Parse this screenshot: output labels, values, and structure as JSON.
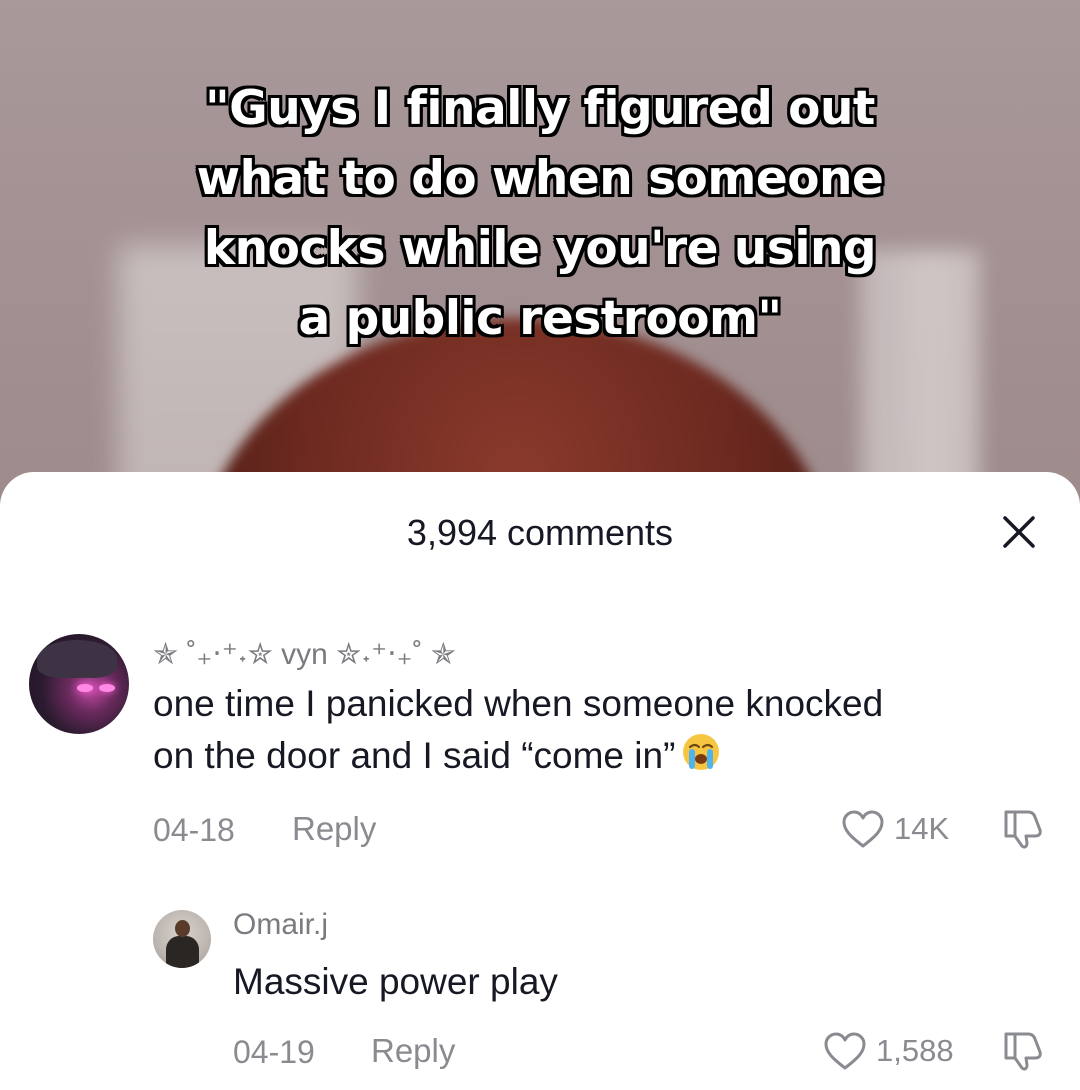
{
  "video": {
    "caption_lines": [
      "\"Guys I finally figured out",
      "what to do when someone",
      "knocks while you're using",
      "a public restroom\""
    ]
  },
  "comments_sheet": {
    "title": "3,994 comments",
    "close_icon": "close-icon",
    "comments": [
      {
        "username": "✯ ˚₊‧⁺˖✮ vyn ✮˖⁺‧₊˚ ✯",
        "text_lines": [
          "one time I panicked when someone knocked",
          "on the door and I said “come in”"
        ],
        "emoji": "loudly-crying-face",
        "date": "04-18",
        "reply_label": "Reply",
        "likes": "14K"
      },
      {
        "username": "Omair.j",
        "text_lines": [
          "Massive power play"
        ],
        "date": "04-19",
        "reply_label": "Reply",
        "likes": "1,588"
      }
    ]
  },
  "colors": {
    "text_primary": "#161823",
    "text_secondary": "#8a8b91",
    "sheet_background": "#ffffff"
  }
}
